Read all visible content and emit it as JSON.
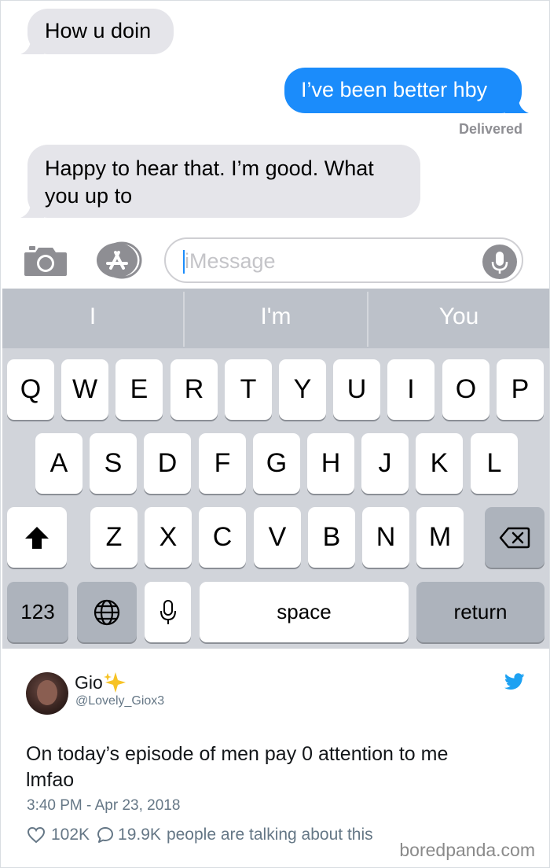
{
  "messages": {
    "m1": "How u doin",
    "m2": "I’ve been better hby",
    "status": "Delivered",
    "m3_line1": "Happy to hear that. I’m good. What",
    "m3_line2": "you up to"
  },
  "compose": {
    "placeholder": "iMessage"
  },
  "keyboard": {
    "suggestions": [
      "I",
      "I'm",
      "You"
    ],
    "row1": [
      "Q",
      "W",
      "E",
      "R",
      "T",
      "Y",
      "U",
      "I",
      "O",
      "P"
    ],
    "row2": [
      "A",
      "S",
      "D",
      "F",
      "G",
      "H",
      "J",
      "K",
      "L"
    ],
    "row3": [
      "Z",
      "X",
      "C",
      "V",
      "B",
      "N",
      "M"
    ],
    "numbers_label": "123",
    "space_label": "space",
    "return_label": "return"
  },
  "tweet": {
    "name": "Gio",
    "handle": "@Lovely_Giox3",
    "text_line1": "On today’s episode of men pay 0 attention to me",
    "text_line2": "lmfao",
    "timestamp": "3:40 PM - Apr 23, 2018",
    "likes": "102K",
    "comments": "19.9K",
    "talking": "people are talking about this"
  },
  "watermark": "boredpanda.com",
  "colors": {
    "outgoing_bubble": "#1b8cfb",
    "incoming_bubble": "#e5e5ea",
    "twitter_blue": "#1da1f2"
  },
  "icons": [
    "camera-icon",
    "app-store-icon",
    "microphone-icon",
    "shift-icon",
    "backspace-icon",
    "globe-icon",
    "dictation-icon",
    "twitter-bird-icon",
    "heart-icon",
    "comment-icon",
    "sparkle-icon"
  ]
}
